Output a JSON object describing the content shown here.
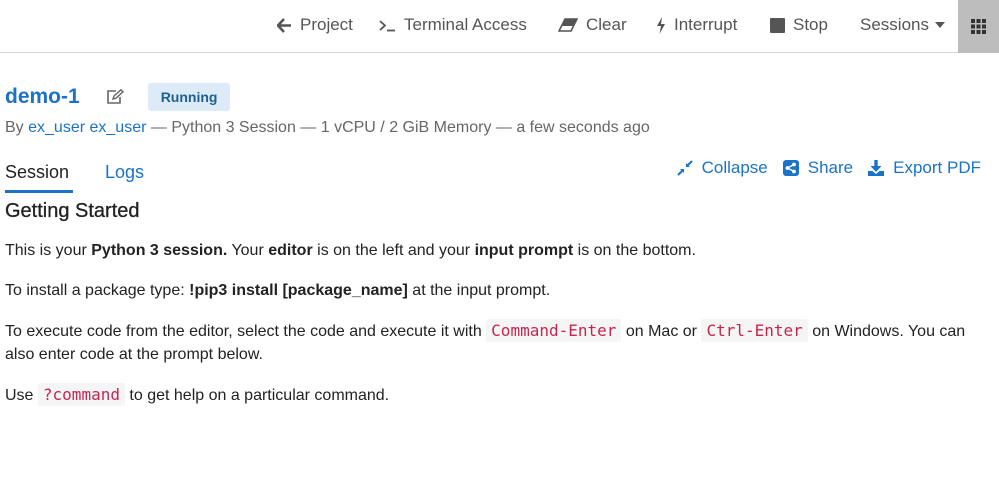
{
  "topbar": {
    "project_label": "Project",
    "terminal_label": "Terminal Access",
    "clear_label": "Clear",
    "interrupt_label": "Interrupt",
    "stop_label": "Stop",
    "sessions_label": "Sessions"
  },
  "session": {
    "title": "demo-1",
    "status": "Running",
    "by": "By",
    "user": "ex_user ex_user",
    "details": "— Python 3 Session — 1 vCPU / 2 GiB Memory — a few seconds ago"
  },
  "tabs": {
    "session": "Session",
    "logs": "Logs"
  },
  "actions": {
    "collapse": "Collapse",
    "share": "Share",
    "export": "Export PDF"
  },
  "content": {
    "heading": "Getting Started",
    "p1": {
      "a": "This is your ",
      "b": "Python 3 session.",
      "c": " Your ",
      "d": "editor",
      "e": " is on the left and your ",
      "f": "input prompt",
      "g": " is on the bottom."
    },
    "p2": {
      "a": "To install a package type: ",
      "b": "!pip3 install [package_name]",
      "c": " at the input prompt."
    },
    "p3": {
      "a": "To execute code from the editor, select the code and execute it with ",
      "code1": "Command-Enter",
      "b": " on Mac or ",
      "code2": "Ctrl-Enter",
      "c": " on Windows. You can also enter code at the prompt below."
    },
    "p4": {
      "a": "Use ",
      "code": "?command",
      "b": " to get help on a particular command."
    }
  },
  "colors": {
    "accent": "#1a73c7",
    "badge_bg": "#dcebf7",
    "code": "#c7254e",
    "grid_bg": "#bdbdbd"
  }
}
